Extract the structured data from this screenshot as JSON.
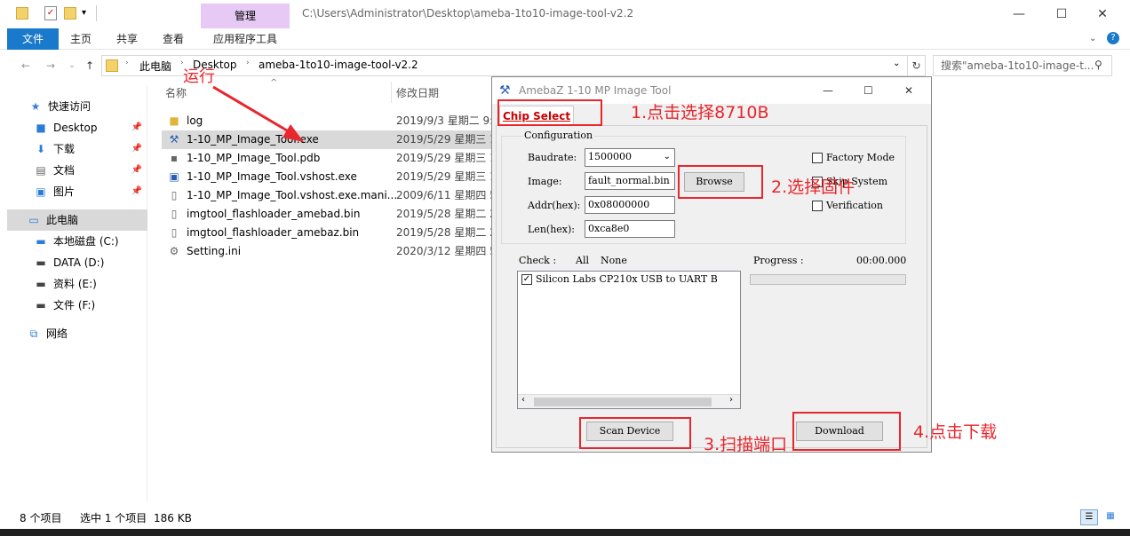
{
  "titlebar": {
    "context_tab": "管理",
    "path": "C:\\Users\\Administrator\\Desktop\\ameba-1to10-image-tool-v2.2",
    "minimize": "—",
    "maximize": "☐",
    "close": "✕"
  },
  "ribbon": {
    "tabs": [
      "文件",
      "主页",
      "共享",
      "查看",
      "应用程序工具"
    ]
  },
  "address": {
    "crumbs": [
      "此电脑",
      "Desktop",
      "ameba-1to10-image-tool-v2.2"
    ],
    "search_placeholder": "搜索\"ameba-1to10-image-t..."
  },
  "sidebar": {
    "items": [
      {
        "label": "快速访问",
        "icon": "star-icon"
      },
      {
        "label": "Desktop",
        "icon": "desktop-folder-icon",
        "pinned": true
      },
      {
        "label": "下载",
        "icon": "download-icon",
        "pinned": true
      },
      {
        "label": "文档",
        "icon": "documents-icon",
        "pinned": true
      },
      {
        "label": "图片",
        "icon": "pictures-icon",
        "pinned": true
      },
      {
        "label": "此电脑",
        "icon": "computer-icon",
        "selected": true
      },
      {
        "label": "本地磁盘 (C:)",
        "icon": "drive-icon"
      },
      {
        "label": "DATA (D:)",
        "icon": "drive-icon"
      },
      {
        "label": "资料 (E:)",
        "icon": "drive-icon"
      },
      {
        "label": "文件 (F:)",
        "icon": "drive-icon"
      },
      {
        "label": "网络",
        "icon": "network-icon"
      }
    ]
  },
  "file_list": {
    "headers": {
      "name": "名称",
      "date": "修改日期"
    },
    "files": [
      {
        "name": "log",
        "date": "2019/9/3 星期二 9:4",
        "icon": "folder-icon"
      },
      {
        "name": "1-10_MP_Image_Tool.exe",
        "date": "2019/5/29 星期三 1",
        "icon": "exe-icon",
        "selected": true
      },
      {
        "name": "1-10_MP_Image_Tool.pdb",
        "date": "2019/5/29 星期三 1",
        "icon": "pdb-file-icon"
      },
      {
        "name": "1-10_MP_Image_Tool.vshost.exe",
        "date": "2019/5/29 星期三 1",
        "icon": "window-exe-icon"
      },
      {
        "name": "1-10_MP_Image_Tool.vshost.exe.mani...",
        "date": "2009/6/11 星期四 5",
        "icon": "file-icon"
      },
      {
        "name": "imgtool_flashloader_amebad.bin",
        "date": "2019/5/28 星期二 2",
        "icon": "file-icon"
      },
      {
        "name": "imgtool_flashloader_amebaz.bin",
        "date": "2019/5/28 星期二 2",
        "icon": "file-icon"
      },
      {
        "name": "Setting.ini",
        "date": "2020/3/12 星期四 5",
        "icon": "settings-file-icon"
      }
    ]
  },
  "status": {
    "count": "8 个项目",
    "selection": "选中 1 个项目",
    "size": "186 KB"
  },
  "dialog": {
    "title": "AmebaZ 1-10 MP Image Tool",
    "chip_tab": "Chip Select",
    "config_legend": "Configuration",
    "baudrate_label": "Baudrate:",
    "baudrate_value": "1500000",
    "image_label": "Image:",
    "image_value": "fault_normal.bin",
    "addr_label": "Addr(hex):",
    "addr_value": "0x08000000",
    "len_label": "Len(hex):",
    "len_value": "0xca8e0",
    "browse": "Browse",
    "factory_mode": "Factory Mode",
    "skip_system": "Skip System",
    "verification": "Verification",
    "check_label": "Check :",
    "check_all": "All",
    "check_none": "None",
    "progress_label": "Progress :",
    "progress_time": "00:00.000",
    "progress": 0,
    "device": "Silicon Labs CP210x USB to UART B",
    "device_checked": true,
    "scan": "Scan Device",
    "download": "Download"
  },
  "annotations": {
    "run": "运行",
    "step1": "1.点击选择8710B",
    "step2": "2.选择固件",
    "step3": "3.扫描端口",
    "step4": "4.点击下载"
  },
  "colors": {
    "annotation": "#e8262d",
    "accent": "#1979ca",
    "context_tab": "#e7c9f5"
  }
}
